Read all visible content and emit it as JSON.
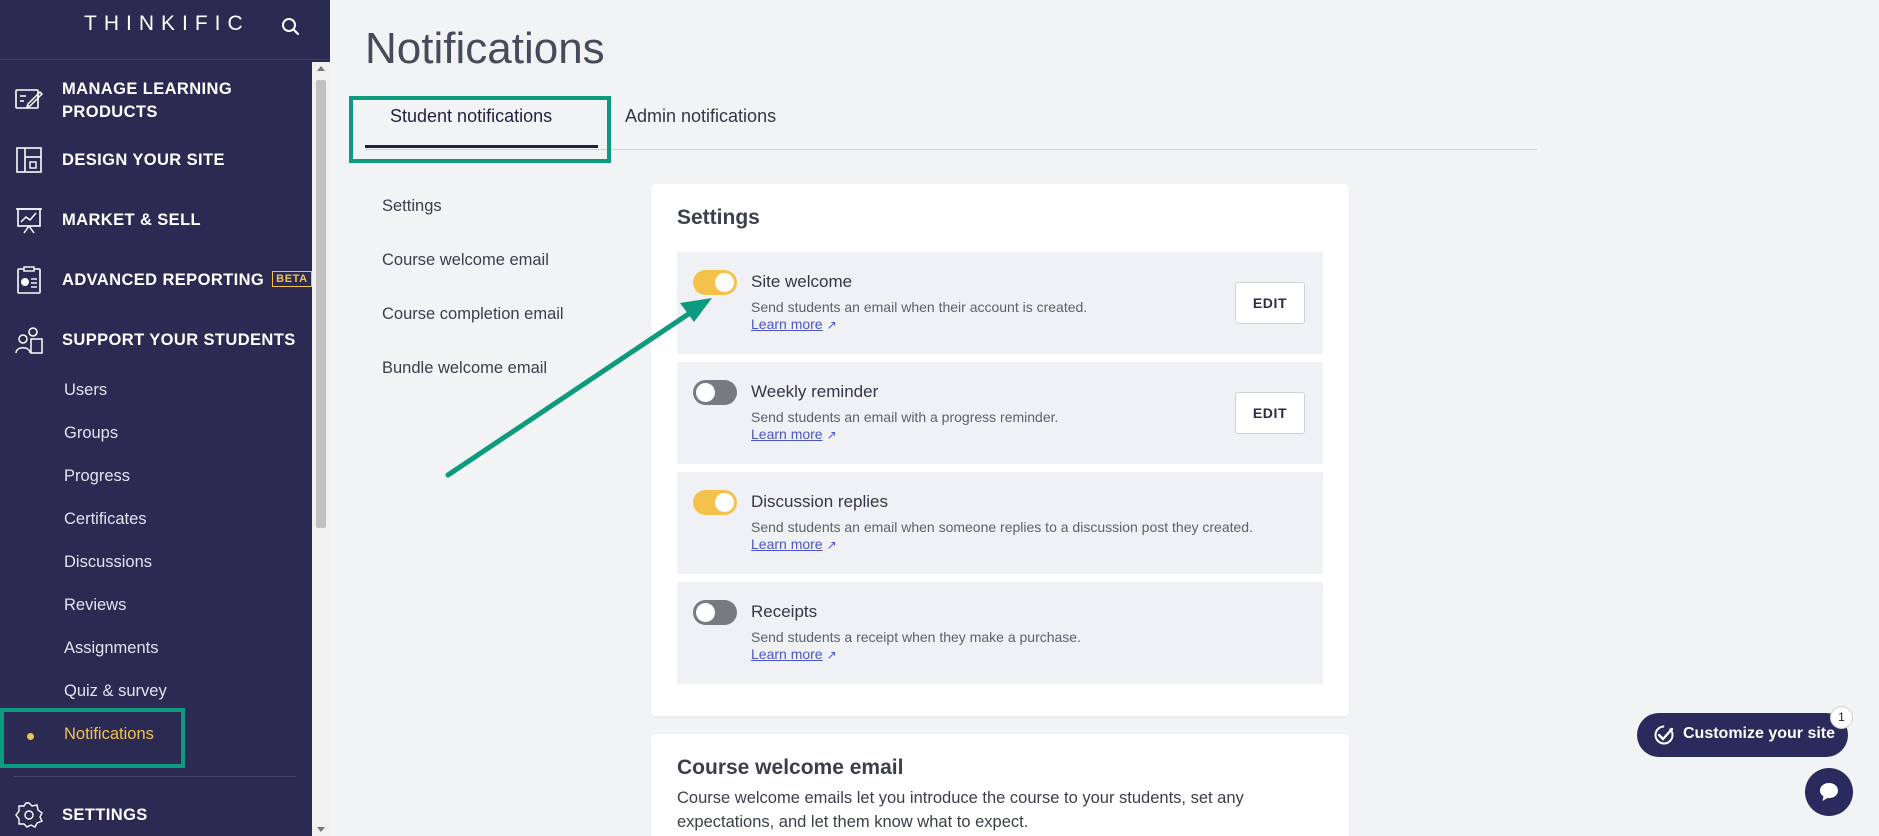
{
  "sidebar": {
    "brand": "THINKIFIC",
    "main_items": [
      {
        "label": "MANAGE LEARNING",
        "label2": "PRODUCTS"
      },
      {
        "label": "DESIGN YOUR SITE"
      },
      {
        "label": "MARKET & SELL"
      },
      {
        "label": "ADVANCED REPORTING",
        "badge": "BETA"
      },
      {
        "label": "SUPPORT YOUR STUDENTS"
      },
      {
        "label": "SETTINGS"
      }
    ],
    "sub_items": [
      "Users",
      "Groups",
      "Progress",
      "Certificates",
      "Discussions",
      "Reviews",
      "Assignments",
      "Quiz & survey",
      "Notifications"
    ],
    "active_item": "Notifications"
  },
  "page": {
    "title": "Notifications",
    "tabs": [
      "Student notifications",
      "Admin notifications"
    ],
    "active_tab": "Student notifications"
  },
  "subnav": [
    "Settings",
    "Course welcome email",
    "Course completion email",
    "Bundle welcome email"
  ],
  "settings_card": {
    "title": "Settings",
    "rows": [
      {
        "title": "Site welcome",
        "description": "Send students an email when their account is created.",
        "link": "Learn more",
        "enabled": true,
        "edit": "EDIT"
      },
      {
        "title": "Weekly reminder",
        "description": "Send students an email with a progress reminder.",
        "link": "Learn more",
        "enabled": false,
        "edit": "EDIT"
      },
      {
        "title": "Discussion replies",
        "description": "Send students an email when someone replies to a discussion post they created.",
        "link": "Learn more",
        "enabled": true
      },
      {
        "title": "Receipts",
        "description": "Send students a receipt when they make a purchase.",
        "link": "Learn more",
        "enabled": false
      }
    ]
  },
  "course_welcome_card": {
    "title": "Course welcome email",
    "text": "Course welcome emails let you introduce the course to your students, set any expectations, and let them know what to expect."
  },
  "floating": {
    "customize_label": "Customize your site",
    "badge_count": "1"
  },
  "colors": {
    "sidebar_bg": "#2a2a52",
    "accent_yellow": "#f3c24b",
    "highlight_green": "#0d9b7f",
    "navy": "#2a2a5c"
  }
}
